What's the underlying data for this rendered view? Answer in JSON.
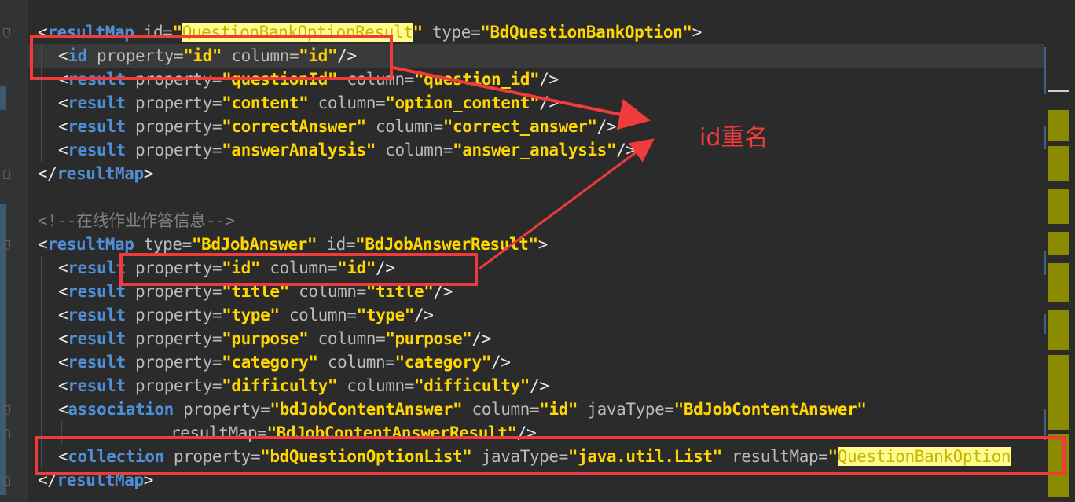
{
  "editor": {
    "lines": [
      {
        "indent": 0,
        "tokens": [
          [
            "pun",
            "<"
          ],
          [
            "tagname",
            "resultMap"
          ],
          [
            "attr",
            " id="
          ],
          [
            "val",
            "\""
          ],
          [
            "hl",
            "QuestionBankOptionResult"
          ],
          [
            "val",
            "\""
          ],
          [
            "attr",
            " type="
          ],
          [
            "val",
            "\"BdQuestionBankOption\""
          ],
          [
            "pun",
            ">"
          ]
        ]
      },
      {
        "indent": 1,
        "tokens": [
          [
            "pun",
            "<"
          ],
          [
            "tagname",
            "id"
          ],
          [
            "attr",
            " property="
          ],
          [
            "val",
            "\"id\""
          ],
          [
            "attr",
            " column="
          ],
          [
            "val",
            "\"id\""
          ],
          [
            "pun",
            "/>"
          ]
        ]
      },
      {
        "indent": 1,
        "tokens": [
          [
            "pun",
            "<"
          ],
          [
            "tagname",
            "result"
          ],
          [
            "attr",
            " property="
          ],
          [
            "val",
            "\"questionId\""
          ],
          [
            "attr",
            " column="
          ],
          [
            "val",
            "\"question_id\""
          ],
          [
            "pun",
            "/>"
          ]
        ]
      },
      {
        "indent": 1,
        "tokens": [
          [
            "pun",
            "<"
          ],
          [
            "tagname",
            "result"
          ],
          [
            "attr",
            " property="
          ],
          [
            "val",
            "\"content\""
          ],
          [
            "attr",
            " column="
          ],
          [
            "val",
            "\"option_content\""
          ],
          [
            "pun",
            "/>"
          ]
        ]
      },
      {
        "indent": 1,
        "tokens": [
          [
            "pun",
            "<"
          ],
          [
            "tagname",
            "result"
          ],
          [
            "attr",
            " property="
          ],
          [
            "val",
            "\"correctAnswer\""
          ],
          [
            "attr",
            " column="
          ],
          [
            "val",
            "\"correct_answer\""
          ],
          [
            "pun",
            "/>"
          ]
        ]
      },
      {
        "indent": 1,
        "tokens": [
          [
            "pun",
            "<"
          ],
          [
            "tagname",
            "result"
          ],
          [
            "attr",
            " property="
          ],
          [
            "val",
            "\"answerAnalysis\""
          ],
          [
            "attr",
            " column="
          ],
          [
            "val",
            "\"answer_analysis\""
          ],
          [
            "pun",
            "/>"
          ]
        ]
      },
      {
        "indent": 0,
        "tokens": [
          [
            "pun",
            "</"
          ],
          [
            "tagname",
            "resultMap"
          ],
          [
            "pun",
            ">"
          ]
        ]
      },
      {
        "indent": 0,
        "tokens": []
      },
      {
        "indent": 0,
        "tokens": [
          [
            "comment",
            "<!--在线作业作答信息-->"
          ]
        ]
      },
      {
        "indent": 0,
        "tokens": [
          [
            "pun",
            "<"
          ],
          [
            "tagname",
            "resultMap"
          ],
          [
            "attr",
            " type="
          ],
          [
            "val",
            "\"BdJobAnswer\""
          ],
          [
            "attr",
            " id="
          ],
          [
            "val",
            "\"BdJobAnswerResult\""
          ],
          [
            "pun",
            ">"
          ]
        ]
      },
      {
        "indent": 1,
        "tokens": [
          [
            "pun",
            "<"
          ],
          [
            "tagname",
            "result"
          ],
          [
            "attr",
            " property="
          ],
          [
            "val",
            "\"id\""
          ],
          [
            "attr",
            " column="
          ],
          [
            "val",
            "\"id\""
          ],
          [
            "pun",
            "/>"
          ]
        ]
      },
      {
        "indent": 1,
        "tokens": [
          [
            "pun",
            "<"
          ],
          [
            "tagname",
            "result"
          ],
          [
            "attr",
            " property="
          ],
          [
            "val",
            "\"title\""
          ],
          [
            "attr",
            " column="
          ],
          [
            "val",
            "\"title\""
          ],
          [
            "pun",
            "/>"
          ]
        ]
      },
      {
        "indent": 1,
        "tokens": [
          [
            "pun",
            "<"
          ],
          [
            "tagname",
            "result"
          ],
          [
            "attr",
            " property="
          ],
          [
            "val",
            "\"type\""
          ],
          [
            "attr",
            " column="
          ],
          [
            "val",
            "\"type\""
          ],
          [
            "pun",
            "/>"
          ]
        ]
      },
      {
        "indent": 1,
        "tokens": [
          [
            "pun",
            "<"
          ],
          [
            "tagname",
            "result"
          ],
          [
            "attr",
            " property="
          ],
          [
            "val",
            "\"purpose\""
          ],
          [
            "attr",
            " column="
          ],
          [
            "val",
            "\"purpose\""
          ],
          [
            "pun",
            "/>"
          ]
        ]
      },
      {
        "indent": 1,
        "tokens": [
          [
            "pun",
            "<"
          ],
          [
            "tagname",
            "result"
          ],
          [
            "attr",
            " property="
          ],
          [
            "val",
            "\"category\""
          ],
          [
            "attr",
            " column="
          ],
          [
            "val",
            "\"category\""
          ],
          [
            "pun",
            "/>"
          ]
        ]
      },
      {
        "indent": 1,
        "tokens": [
          [
            "pun",
            "<"
          ],
          [
            "tagname",
            "result"
          ],
          [
            "attr",
            " property="
          ],
          [
            "val",
            "\"difficulty\""
          ],
          [
            "attr",
            " column="
          ],
          [
            "val",
            "\"difficulty\""
          ],
          [
            "pun",
            "/>"
          ]
        ]
      },
      {
        "indent": 1,
        "tokens": [
          [
            "pun",
            "<"
          ],
          [
            "tagname",
            "association"
          ],
          [
            "attr",
            " property="
          ],
          [
            "val",
            "\"bdJobContentAnswer\""
          ],
          [
            "attr",
            " column="
          ],
          [
            "val",
            "\"id\""
          ],
          [
            "attr",
            " javaType="
          ],
          [
            "val",
            "\"BdJobContentAnswer\""
          ]
        ]
      },
      {
        "indent": 6.5,
        "tokens": [
          [
            "attr",
            "resultMap="
          ],
          [
            "val",
            "\"BdJobContentAnswerResult\""
          ],
          [
            "pun",
            "/>"
          ]
        ]
      },
      {
        "indent": 1,
        "tokens": [
          [
            "pun",
            "<"
          ],
          [
            "tagname",
            "collection"
          ],
          [
            "attr",
            " property="
          ],
          [
            "val",
            "\"bdQuestionOptionList\""
          ],
          [
            "attr",
            " javaType="
          ],
          [
            "val",
            "\"java.util.List\""
          ],
          [
            "attr",
            " resultMap="
          ],
          [
            "val",
            "\""
          ],
          [
            "hl",
            "QuestionBankOption"
          ]
        ]
      },
      {
        "indent": 0,
        "tokens": [
          [
            "pun",
            "</"
          ],
          [
            "tagname",
            "resultMap"
          ],
          [
            "pun",
            ">"
          ]
        ]
      }
    ]
  },
  "annotation": {
    "label": "id重名",
    "color": "#ef3b3b"
  },
  "colors": {
    "background": "#2b2b2b",
    "tag_name": "#4f8fd8",
    "attribute": "#bababa",
    "value": "#ffd700",
    "comment": "#808080",
    "highlight": "#fffb8f",
    "annotation": "#ef3b3b"
  }
}
